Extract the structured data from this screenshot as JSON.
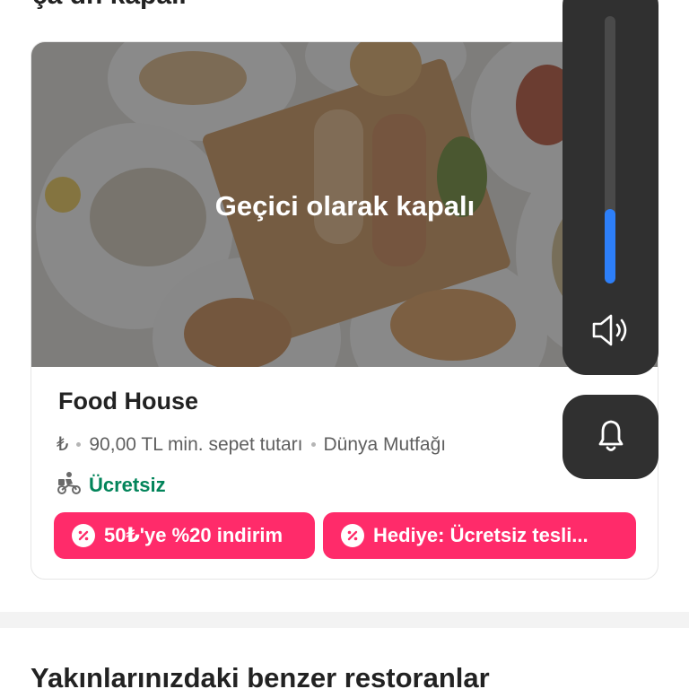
{
  "headings": {
    "top_partial": "ça dn kapalı",
    "similar_restaurants": "Yakınlarınızdaki benzer restoranlar"
  },
  "restaurant": {
    "status_overlay": "Geçici olarak kapalı",
    "name": "Food House",
    "price_symbol": "₺",
    "min_basket": "90,00 TL min. sepet tutarı",
    "cuisine": "Dünya Mutfağı",
    "delivery_fee": "Ücretsiz",
    "offers": [
      {
        "label": "50₺'ye %20 indirim"
      },
      {
        "label": "Hediye: Ücretsiz tesli..."
      }
    ]
  },
  "system_overlay": {
    "volume_level": 0.28,
    "volume_icon": "speaker-icon",
    "ringer_icon": "bell-icon"
  },
  "colors": {
    "offer_chip": "#ff2b6a",
    "free_delivery": "#02845a",
    "volume_accent": "#2d7ff9",
    "overlay_panel": "#303030"
  }
}
